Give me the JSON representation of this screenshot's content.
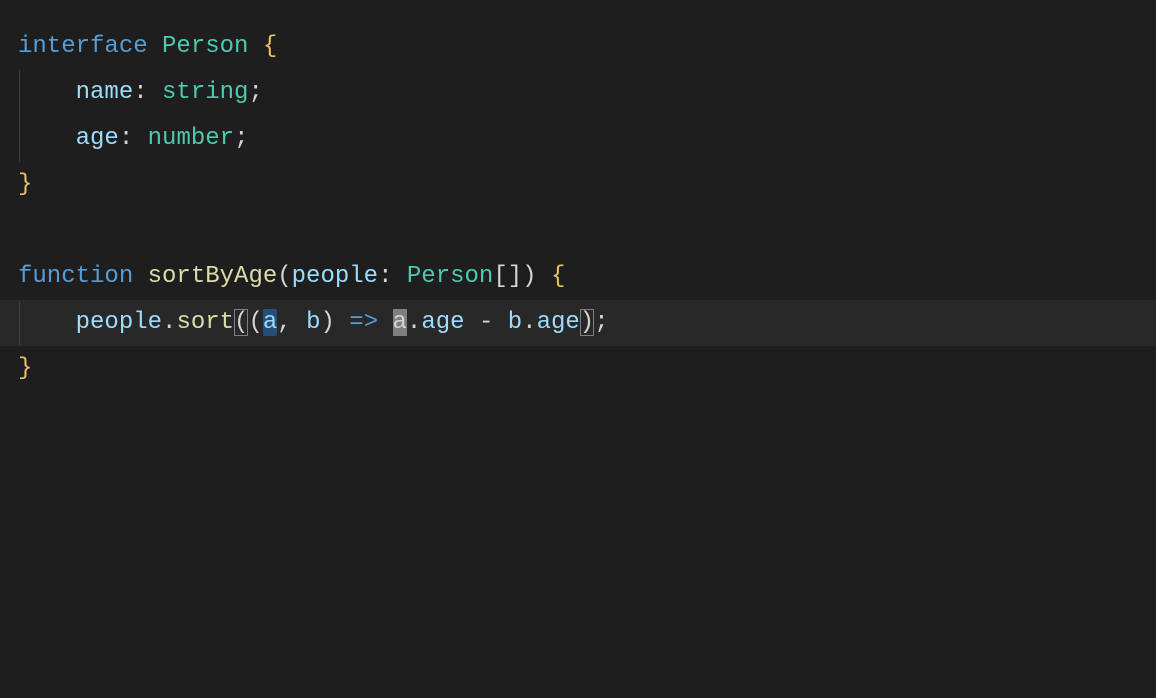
{
  "code": {
    "line1": {
      "kw": "interface",
      "type": "Person",
      "brace": "{"
    },
    "line2": {
      "field": "name",
      "colon": ":",
      "ftype": "string",
      "semi": ";"
    },
    "line3": {
      "field": "age",
      "colon": ":",
      "ftype": "number",
      "semi": ";"
    },
    "line4": {
      "brace": "}"
    },
    "line6": {
      "kw": "function",
      "fn": "sortByAge",
      "po": "(",
      "param": "people",
      "colon": ":",
      "ptype": "Person",
      "bo": "[",
      "bc": "]",
      "pc": ")",
      "brace": "{"
    },
    "line7": {
      "indent": "    ",
      "obj": "people",
      "dot1": ".",
      "method": "sort",
      "po1": "(",
      "po2": "(",
      "a": "a",
      "comma": ",",
      "b": "b",
      "pc2": ")",
      "arrow": "=>",
      "a2": "a",
      "dot2": ".",
      "age1": "age",
      "minus": "-",
      "b2": "b",
      "dot3": ".",
      "age2": "age",
      "pc1": ")",
      "semi": ";"
    },
    "line8": {
      "brace": "}"
    }
  }
}
